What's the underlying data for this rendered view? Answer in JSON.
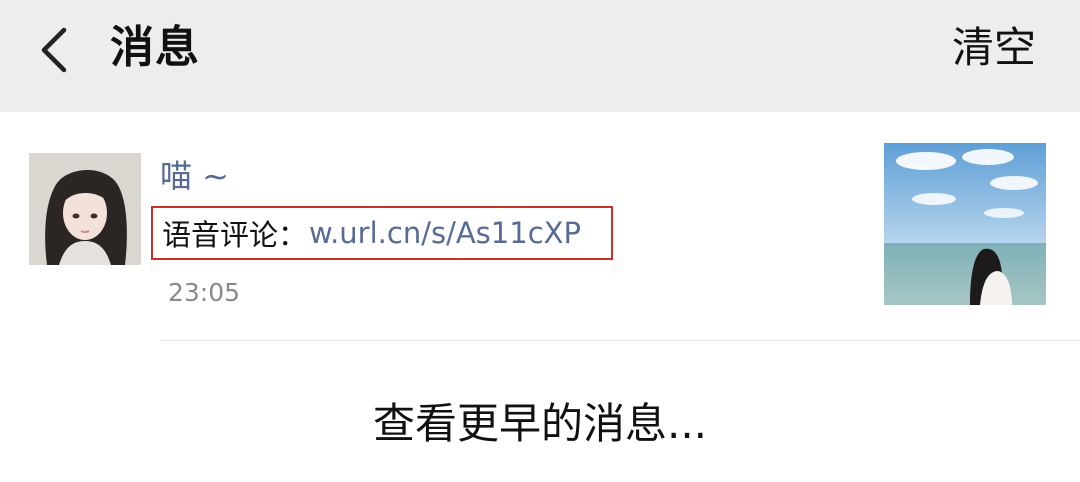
{
  "header": {
    "back_icon": "chevron-left-icon",
    "title": "消息",
    "clear_label": "清空"
  },
  "message": {
    "sender": "喵 ~",
    "comment_prefix": "语音评论：",
    "comment_link": "w.url.cn/s/As11cXP",
    "time": "23:05"
  },
  "footer": {
    "load_more_label": "查看更早的消息..."
  },
  "colors": {
    "header_bg": "#ededed",
    "link": "#576b95",
    "highlight_border": "#c9302c",
    "timestamp": "#8a8a8a"
  }
}
